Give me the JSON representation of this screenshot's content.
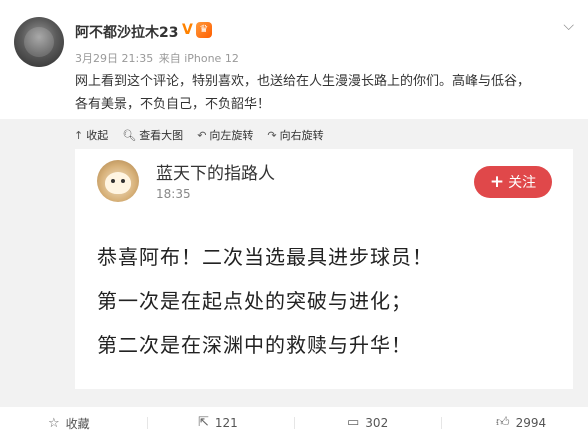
{
  "post": {
    "username": "阿不都沙拉木23",
    "verified_mark": "V",
    "vip_icon": "vip-badge-icon",
    "date": "3月29日 21:35",
    "source": "来自 iPhone 12",
    "text_line1": "网上看到这个评论，特别喜欢，也送给在人生漫漫长路上的你们。高峰与低谷，",
    "text_line2": "各有美景，不负自己，不负韶华！"
  },
  "toolbar": {
    "collapse": "收起",
    "view_large": "查看大图",
    "rotate_left": "向左旋转",
    "rotate_right": "向右旋转"
  },
  "card": {
    "name": "蓝天下的指路人",
    "time": "18:35",
    "follow": "关注",
    "line1": "恭喜阿布！二次当选最具进步球员！",
    "line2": "第一次是在起点处的突破与进化；",
    "line3": "第二次是在深渊中的救赎与升华！"
  },
  "actions": {
    "favorite": "收藏",
    "repost_count": "121",
    "comment_count": "302",
    "like_count": "2994"
  },
  "colors": {
    "follow_button": "#e0484a",
    "verified": "#ff8200"
  }
}
